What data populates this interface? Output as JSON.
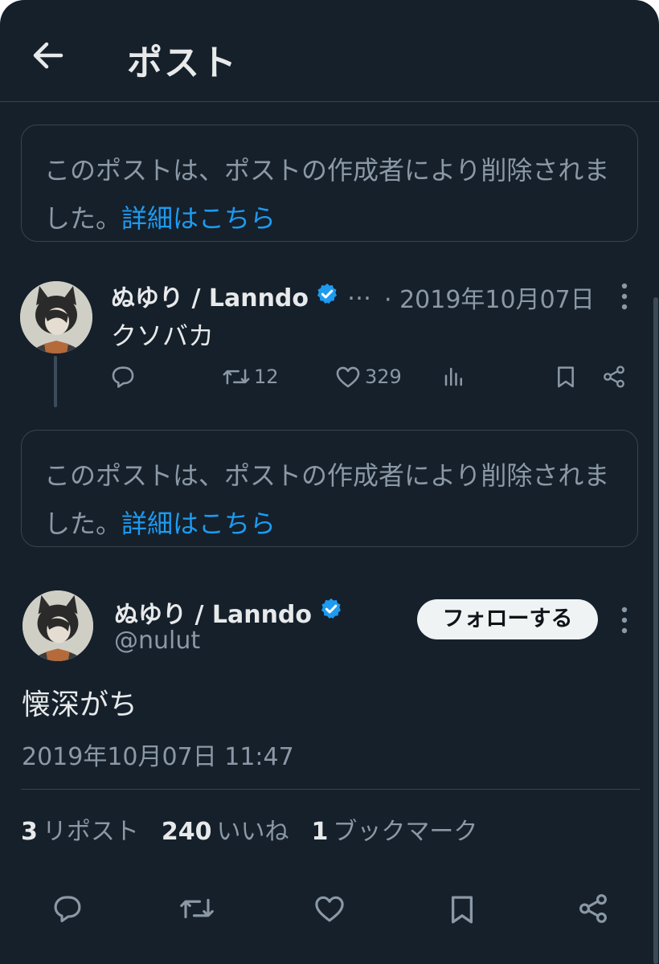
{
  "header": {
    "title": "ポスト"
  },
  "deleted_notice": {
    "text_line1": "このポストは、ポストの作成者により削除されま",
    "text_line2_prefix": "した。",
    "link": "詳細はこちら"
  },
  "reply_post": {
    "display_name": "ぬゆり / Lanndo",
    "ellipsis": "…",
    "date": "· 2019年10月07日",
    "text": "クソバカ",
    "retweets": "12",
    "likes": "329"
  },
  "main_post": {
    "display_name": "ぬゆり / Lanndo",
    "handle": "@nulut",
    "follow_label": "フォローする",
    "text": "懐深がち",
    "timestamp": "2019年10月07日 11:47"
  },
  "stats": {
    "reposts_count": "3",
    "reposts_label": "リポスト",
    "likes_count": "240",
    "likes_label": "いいね",
    "bookmarks_count": "1",
    "bookmarks_label": "ブックマーク"
  },
  "colors": {
    "background": "#15202b",
    "accent": "#1d9bf0",
    "text_primary": "#e7e9ea",
    "text_secondary": "#8b98a5",
    "border": "#38444d"
  },
  "icons": {
    "back": "arrow-left-icon",
    "verified": "verified-badge-icon",
    "reply": "reply-icon",
    "retweet": "retweet-icon",
    "like": "heart-icon",
    "views": "analytics-icon",
    "bookmark": "bookmark-icon",
    "share": "share-icon",
    "more": "more-vertical-icon"
  }
}
